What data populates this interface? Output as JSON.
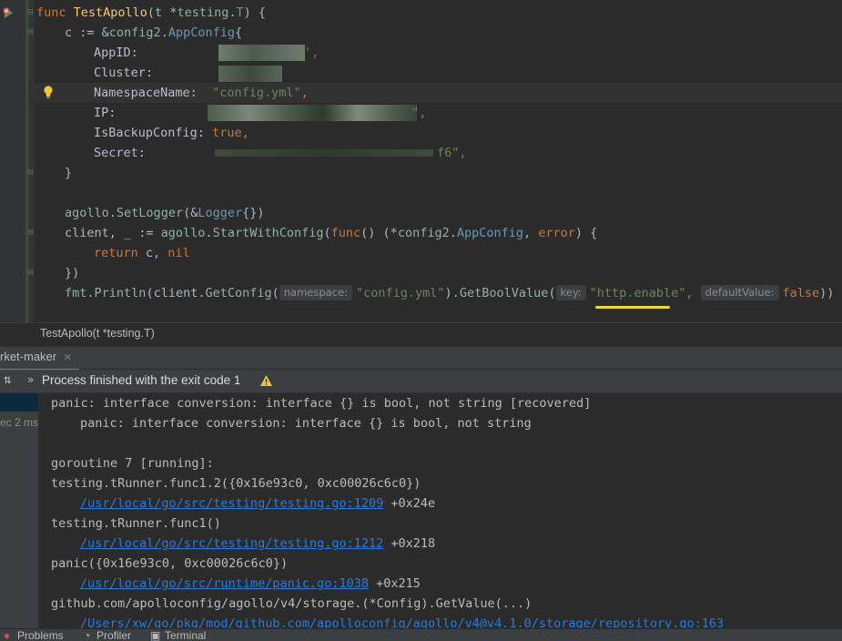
{
  "editor": {
    "lines": {
      "l1": {
        "kw": "func ",
        "name": "TestApollo",
        "rest_a": "(t *",
        "pkg": "testing",
        "dot": ".",
        "type": "T",
        "rest_b": ") {"
      },
      "l2": {
        "a": "c := &",
        "pkg": "config2",
        "dot": ".",
        "type": "AppConfig",
        "b": "{"
      },
      "l3": {
        "field": "AppID:",
        "tail": "',"
      },
      "l4": {
        "field": "Cluster:"
      },
      "l5": {
        "field": "NamespaceName:",
        "value": "\"config.yml\"",
        "comma": ","
      },
      "l6": {
        "field": "IP:",
        "tail": "\","
      },
      "l7": {
        "field": "IsBackupConfig:",
        "value": "true",
        "comma": ","
      },
      "l8": {
        "field": "Secret:",
        "tail": "f6\","
      },
      "l9": {
        "text": "}"
      },
      "l11": {
        "pkg": "agollo",
        "dot": ".",
        "fn": "SetLogger",
        "a": "(&",
        "type": "Logger",
        "b": "{})"
      },
      "l12": {
        "a": "client, _ := ",
        "pkg": "agollo",
        "dot": ".",
        "fn": "StartWithConfig",
        "b": "(",
        "kw": "func",
        "c": "() (*",
        "pkg2": "config2",
        "dot2": ".",
        "type": "AppConfig",
        "d": ", ",
        "kw2": "error",
        "e": ") {"
      },
      "l13": {
        "kw": "return ",
        "a": "c, ",
        "kw2": "nil"
      },
      "l14": {
        "text": "})"
      },
      "l15": {
        "pkg": "fmt",
        "dot": ".",
        "fn": "Println",
        "a": "(client.",
        "fn2": "GetConfig",
        "b": "(",
        "hint1": "namespace:",
        "str1": "\"config.yml\"",
        "c": ").",
        "fn3": "GetBoolValue",
        "d": "(",
        "hint2": "key:",
        "str2": "\"http.enable\"",
        "e": ", ",
        "hint3": "defaultValue:",
        "kw": "false",
        "f": "))"
      }
    }
  },
  "breadcrumb": "TestApollo(t *testing.T)",
  "run": {
    "tab_label": "rket-maker",
    "status": "Process finished with the exit code 1",
    "tree_time": "ec 2 ms"
  },
  "console": {
    "lines": [
      {
        "text": "panic: interface conversion: interface {} is bool, not string [recovered]",
        "indent": false,
        "link": false
      },
      {
        "text": "panic: interface conversion: interface {} is bool, not string",
        "indent": true,
        "link": false
      },
      {
        "text": "",
        "indent": false,
        "link": false
      },
      {
        "text": "goroutine 7 [running]:",
        "indent": false,
        "link": false
      },
      {
        "text": "testing.tRunner.func1.2({0x16e93c0, 0xc00026c6c0})",
        "indent": false,
        "link": false
      },
      {
        "text": "/usr/local/go/src/testing/testing.go:1209",
        "suffix": " +0x24e",
        "indent": true,
        "link": true
      },
      {
        "text": "testing.tRunner.func1()",
        "indent": false,
        "link": false
      },
      {
        "text": "/usr/local/go/src/testing/testing.go:1212",
        "suffix": " +0x218",
        "indent": true,
        "link": true
      },
      {
        "text": "panic({0x16e93c0, 0xc00026c6c0})",
        "indent": false,
        "link": false
      },
      {
        "text": "/usr/local/go/src/runtime/panic.go:1038",
        "suffix": " +0x215",
        "indent": true,
        "link": true
      },
      {
        "text": "github.com/apolloconfig/agollo/v4/storage.(*Config).GetValue(...)",
        "indent": false,
        "link": false
      },
      {
        "text": "/Users/xw/go/pkg/mod/github.com/apolloconfig/agollo/v4@v4.1.0/storage/repository.go:163",
        "suffix": "",
        "indent": true,
        "link": true
      }
    ]
  },
  "statusbar": {
    "problems": "Problems",
    "profiler": "Profiler",
    "terminal": "Terminal"
  },
  "colors": {
    "keyword": "#cc7832",
    "function": "#ffc66d",
    "type": "#6897bb",
    "string": "#6a8759",
    "link": "#287bde",
    "highlight": "#f2d73c"
  }
}
